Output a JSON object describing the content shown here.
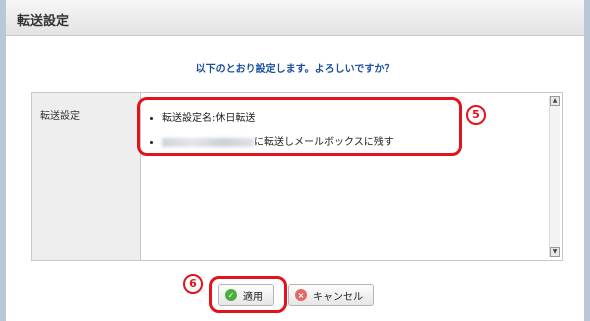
{
  "window": {
    "title": "転送設定"
  },
  "prompt": "以下のとおり設定します。よろしいですか？",
  "settings": {
    "label": "転送設定",
    "items": [
      "転送設定名:休日転送",
      "に転送しメールボックスに残す"
    ]
  },
  "annotations": {
    "step5": "5",
    "step6": "6"
  },
  "buttons": {
    "apply": "適用",
    "cancel": "キャンセル"
  },
  "colors": {
    "highlight": "#e3131b",
    "prompt_text": "#1a4f9c",
    "apply_icon": "#4cae3e",
    "cancel_icon": "#e06a6a"
  }
}
